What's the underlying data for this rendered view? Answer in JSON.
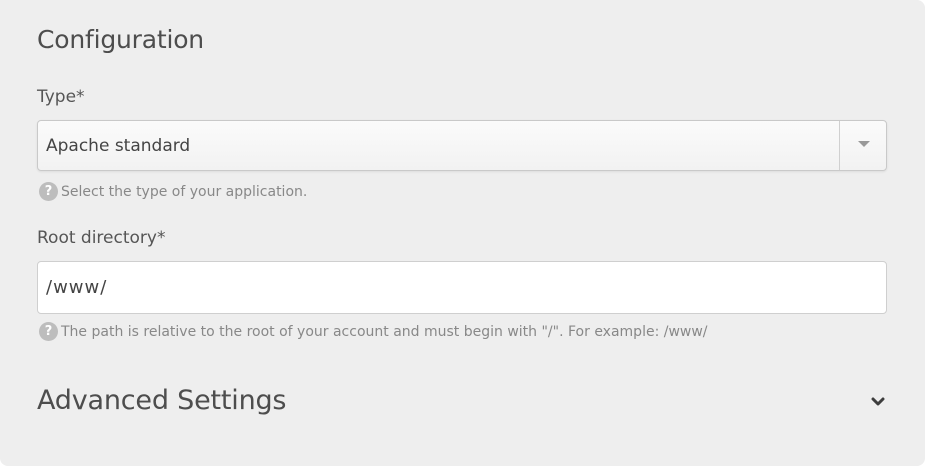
{
  "configuration": {
    "title": "Configuration",
    "type_field": {
      "label": "Type*",
      "selected": "Apache standard",
      "help": "Select the type of your application."
    },
    "root_field": {
      "label": "Root directory*",
      "value": "/www/",
      "help": "The path is relative to the root of your account and must begin with \"/\". For example: /www/"
    },
    "help_icon_glyph": "?"
  },
  "advanced": {
    "title": "Advanced Settings",
    "icon": "chevron-down-icon"
  },
  "colors": {
    "panel_bg": "#eeeeee",
    "text": "#4d4d4d",
    "help_text": "#888888",
    "help_icon_bg": "#bdbdbd"
  }
}
